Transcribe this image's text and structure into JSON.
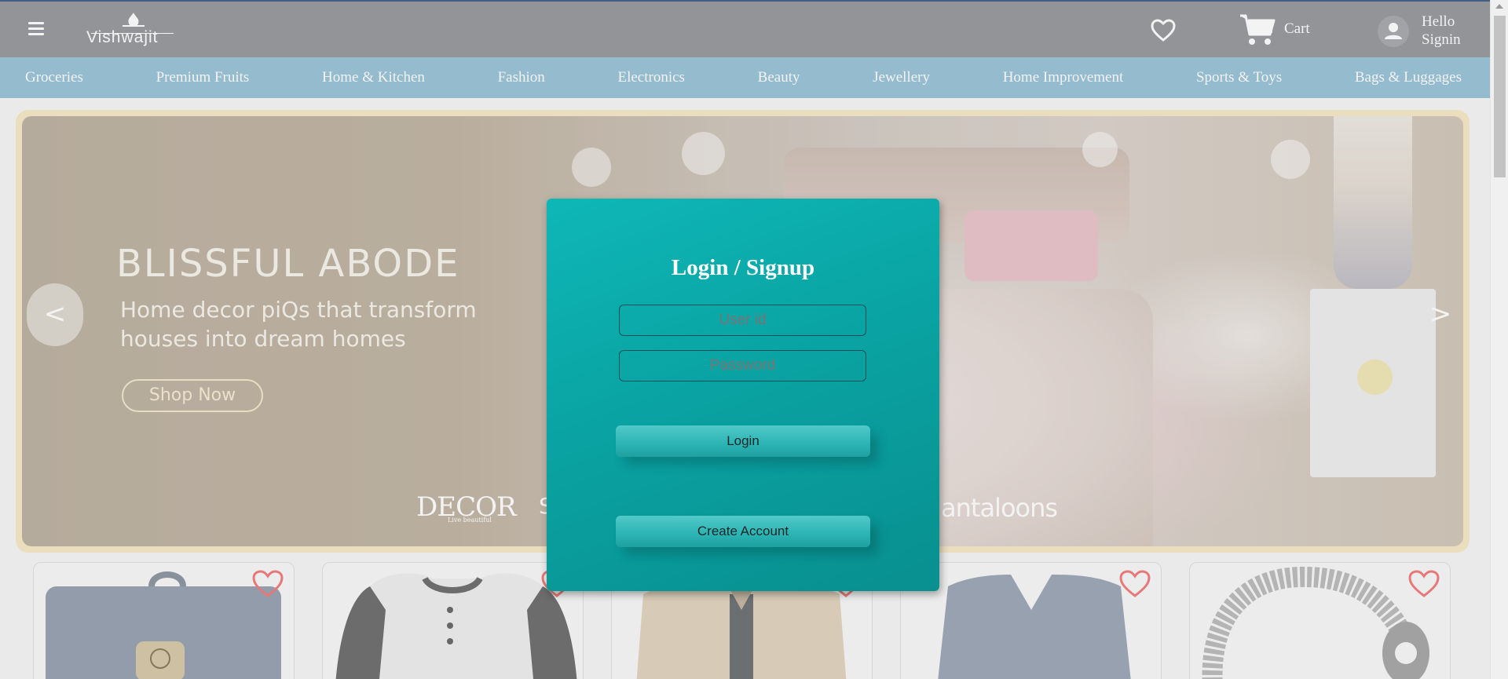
{
  "header": {
    "logo_text": "Vishwajit",
    "cart_label": "Cart",
    "greeting_line1": "Hello",
    "greeting_line2": "Signin",
    "icons": [
      "menu-icon",
      "wishlist-heart-icon",
      "cart-icon",
      "user-icon"
    ]
  },
  "categories": [
    "Groceries",
    "Premium Fruits",
    "Home & Kitchen",
    "Fashion",
    "Electronics",
    "Beauty",
    "Jewellery",
    "Home Improvement",
    "Sports & Toys",
    "Bags & Luggages"
  ],
  "banner": {
    "title": "BLISSFUL ABODE",
    "subtitle": "Home decor piQs that transform houses into dream homes",
    "cta": "Shop Now",
    "brand_1": "DECOR",
    "brand_1_tagline": "Live beautiful",
    "brand_2": "S",
    "brand_3": "antaloons",
    "prev_arrow": "<",
    "next_arrow": ">"
  },
  "products": [
    "backpack",
    "henley-shirt",
    "jacket",
    "v-neck-sweater",
    "bracelet"
  ],
  "modal": {
    "title": "Login / Signup",
    "user_placeholder": "User id",
    "password_placeholder": "Password",
    "login_label": "Login",
    "create_label": "Create Account"
  },
  "colors": {
    "header_bg": "#898b91",
    "nav_bg": "#8bbbd2",
    "modal_bg": "#0aa3a3",
    "heart": "#f06a6a"
  }
}
